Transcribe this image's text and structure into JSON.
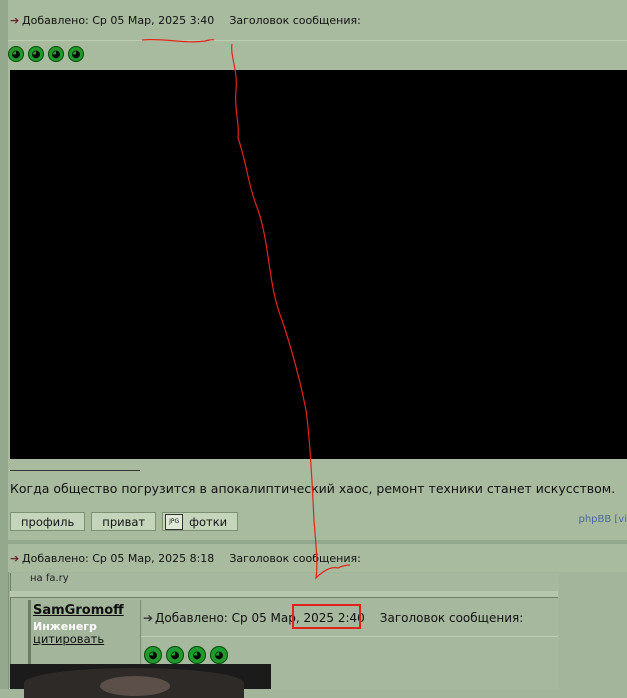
{
  "post1": {
    "added_label": "Добавлено: Ср 05 Мар, 2025 3:40",
    "title_label": "Заголовок сообщения:",
    "signature_text": "Когда общество погрузится в апокалиптический хаос, ремонт техники станет искусством.",
    "video_watermark": "phpBB [vi",
    "buttons": {
      "profile": "профиль",
      "private": "приват",
      "photos": "фотки"
    },
    "photos_icon_text": "JPG"
  },
  "post2": {
    "added_label": "Добавлено: Ср 05 Мар, 2025 8:18",
    "title_label": "Заголовок сообщения:"
  },
  "quote": {
    "top_text": "на fa.ry",
    "username": "SamGromoff",
    "rank": "Инженегр",
    "quote_link": "цитировать",
    "added_label": "Добавлено: Ср 05 Мар, 2025 2:40",
    "title_label": "Заголовок сообщения:"
  },
  "colors": {
    "annotation_red": "#e0241b",
    "smiley_green": "#1f9a2b",
    "arrow": "#6b1f2a"
  },
  "icons": [
    "post-arrow-icon",
    "smiley-icon",
    "jpg-icon"
  ]
}
